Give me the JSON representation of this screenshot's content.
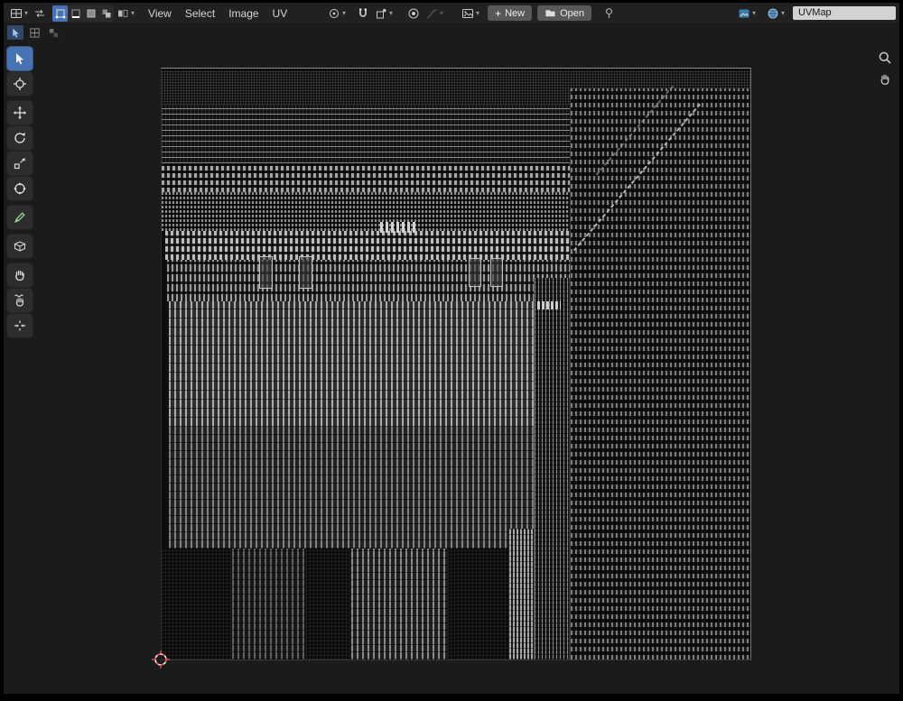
{
  "icons": {
    "chevron_down": "▾",
    "plus": "+"
  },
  "header": {
    "menus": [
      {
        "label": "View"
      },
      {
        "label": "Select"
      },
      {
        "label": "Image"
      },
      {
        "label": "UV"
      }
    ],
    "image_new_label": "New",
    "image_open_label": "Open",
    "uvmap_name": "UVMap"
  },
  "toolbar": {
    "tools": [
      {
        "name": "tweak-select",
        "active": true
      },
      {
        "name": "2d-cursor",
        "active": false
      },
      {
        "name": "move",
        "active": false
      },
      {
        "name": "rotate",
        "active": false
      },
      {
        "name": "scale",
        "active": false
      },
      {
        "name": "transform",
        "active": false
      },
      {
        "name": "annotate",
        "active": false
      },
      {
        "name": "rip-region",
        "active": false
      },
      {
        "name": "grab",
        "active": false
      },
      {
        "name": "relax",
        "active": false
      },
      {
        "name": "pinch",
        "active": false
      }
    ]
  },
  "colors": {
    "accent_blue": "#4772b3",
    "annotate_green": "#93d693",
    "header_bg": "#212121",
    "canvas_bg": "#1b1b1b"
  }
}
